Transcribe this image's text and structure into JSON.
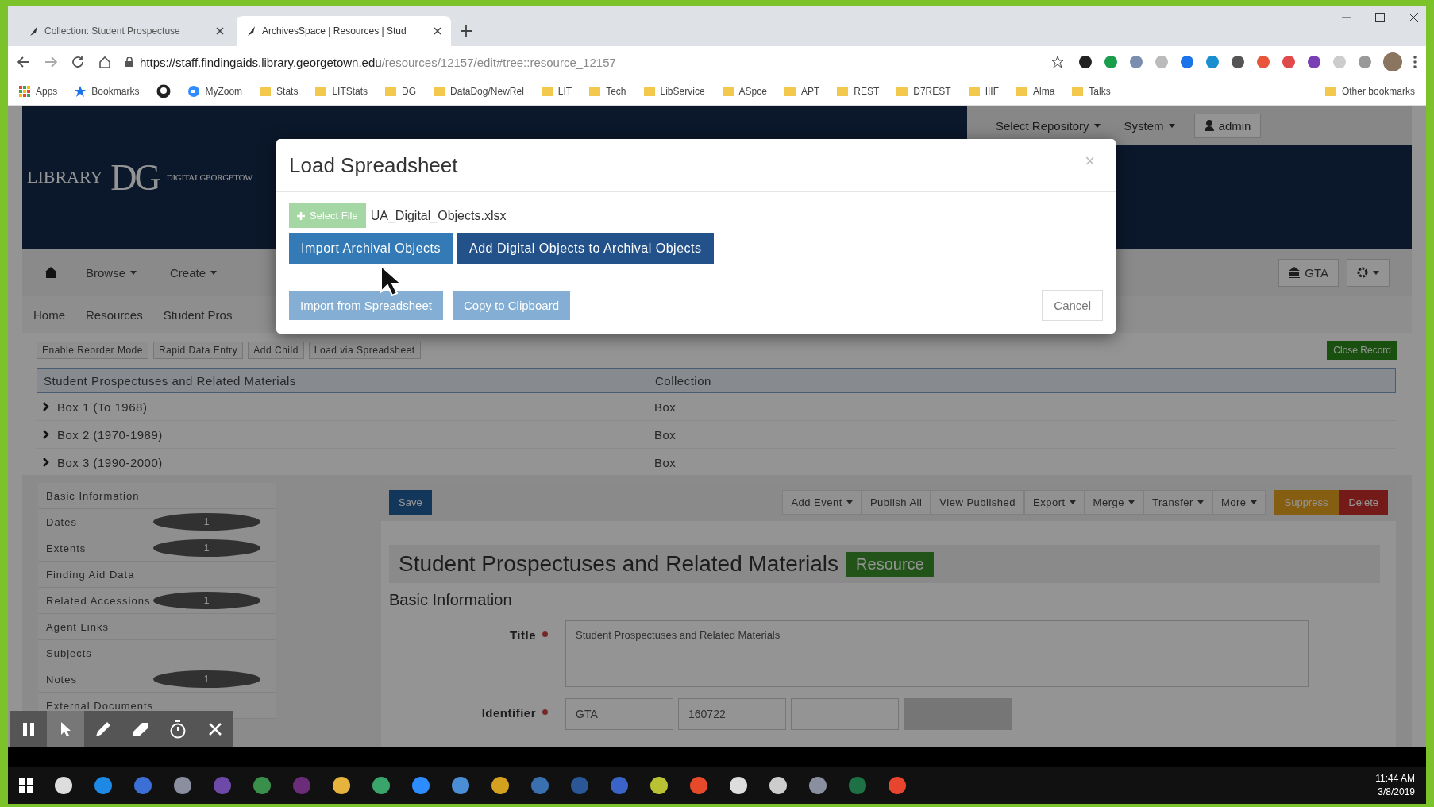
{
  "browser": {
    "tabs": [
      {
        "title": "Collection: Student Prospectuse",
        "selected": false
      },
      {
        "title": "ArchivesSpace | Resources | Stud",
        "selected": true
      }
    ],
    "url_host": "https://staff.findingaids.library.georgetown.edu",
    "url_path": "/resources/12157/edit#tree::resource_12157",
    "bookmarks": [
      {
        "kind": "apps",
        "label": "Apps"
      },
      {
        "kind": "star",
        "label": "Bookmarks"
      },
      {
        "kind": "github"
      },
      {
        "kind": "zoom",
        "label": "MyZoom"
      },
      {
        "kind": "folder",
        "label": "Stats"
      },
      {
        "kind": "folder",
        "label": "LITStats"
      },
      {
        "kind": "folder",
        "label": "DG"
      },
      {
        "kind": "folder",
        "label": "DataDog/NewRel"
      },
      {
        "kind": "folder",
        "label": "LIT"
      },
      {
        "kind": "folder",
        "label": "Tech"
      },
      {
        "kind": "folder",
        "label": "LibService"
      },
      {
        "kind": "folder",
        "label": "ASpce"
      },
      {
        "kind": "folder",
        "label": "APT"
      },
      {
        "kind": "folder",
        "label": "REST"
      },
      {
        "kind": "folder",
        "label": "D7REST"
      },
      {
        "kind": "folder",
        "label": "IIIF"
      },
      {
        "kind": "folder",
        "label": "Alma"
      },
      {
        "kind": "folder",
        "label": "Talks"
      }
    ],
    "other_bookmarks": "Other bookmarks"
  },
  "header": {
    "logo_library": "LIBRARY",
    "logo_dg": "DG",
    "logo_name": "DIGITALGEORGETOW",
    "menus": [
      "Select Repository",
      "System"
    ],
    "user": "admin"
  },
  "nav": {
    "items": [
      "Browse",
      "Create"
    ],
    "repository": "GTA"
  },
  "breadcrumb": [
    "Home",
    "Resources",
    "Student Pros"
  ],
  "tree_toolbar": {
    "buttons": [
      "Enable Reorder Mode",
      "Rapid Data Entry",
      "Add Child",
      "Load via Spreadsheet"
    ],
    "close_record": "Close Record"
  },
  "tree": {
    "title": "Student Prospectuses and Related Materials",
    "level": "Collection",
    "rows": [
      {
        "title": "Box 1 (To 1968)",
        "type": "Box"
      },
      {
        "title": "Box 2 (1970-1989)",
        "type": "Box"
      },
      {
        "title": "Box 3 (1990-2000)",
        "type": "Box"
      }
    ]
  },
  "sidebar": [
    {
      "label": "Basic Information"
    },
    {
      "label": "Dates",
      "count": "1"
    },
    {
      "label": "Extents",
      "count": "1"
    },
    {
      "label": "Finding Aid Data"
    },
    {
      "label": "Related Accessions",
      "count": "1"
    },
    {
      "label": "Agent Links"
    },
    {
      "label": "Subjects"
    },
    {
      "label": "Notes",
      "count": "1"
    },
    {
      "label": "External Documents"
    }
  ],
  "record_toolbar": {
    "save": "Save",
    "buttons": [
      {
        "label": "Add Event",
        "dropdown": true
      },
      {
        "label": "Publish All",
        "dropdown": false
      },
      {
        "label": "View Published",
        "dropdown": false
      },
      {
        "label": "Export",
        "dropdown": true
      },
      {
        "label": "Merge",
        "dropdown": true
      },
      {
        "label": "Transfer",
        "dropdown": true
      },
      {
        "label": "More",
        "dropdown": true
      }
    ],
    "suppress": "Suppress",
    "delete": "Delete"
  },
  "record": {
    "title": "Student Prospectuses and Related Materials",
    "badge": "Resource",
    "section": "Basic Information",
    "title_field": {
      "label": "Title",
      "required": true,
      "value": "Student Prospectuses and Related Materials"
    },
    "identifier_field": {
      "label": "Identifier",
      "required": true,
      "parts": [
        "GTA",
        "160722"
      ]
    }
  },
  "modal": {
    "title": "Load Spreadsheet",
    "close": "×",
    "select_file": {
      "label": "Select File",
      "disabled": true
    },
    "filename": "UA_Digital_Objects.xlsx",
    "actions": [
      {
        "label": "Import Archival Objects",
        "selected": false
      },
      {
        "label": "Add Digital Objects to Archival Objects",
        "selected": true
      }
    ],
    "footer": [
      {
        "label": "Import from Spreadsheet",
        "disabled": true
      },
      {
        "label": "Copy to Clipboard",
        "disabled": true
      }
    ],
    "cancel": "Cancel"
  },
  "recorder": {
    "tools": [
      {
        "kind": "pause",
        "selected": false
      },
      {
        "kind": "pointer",
        "selected": true
      },
      {
        "kind": "pen",
        "selected": false
      },
      {
        "kind": "eraser",
        "selected": false
      },
      {
        "kind": "timer",
        "selected": false
      },
      {
        "kind": "close",
        "selected": false
      }
    ]
  },
  "taskbar": {
    "time": "11:44 AM",
    "date": "3/8/2019"
  }
}
